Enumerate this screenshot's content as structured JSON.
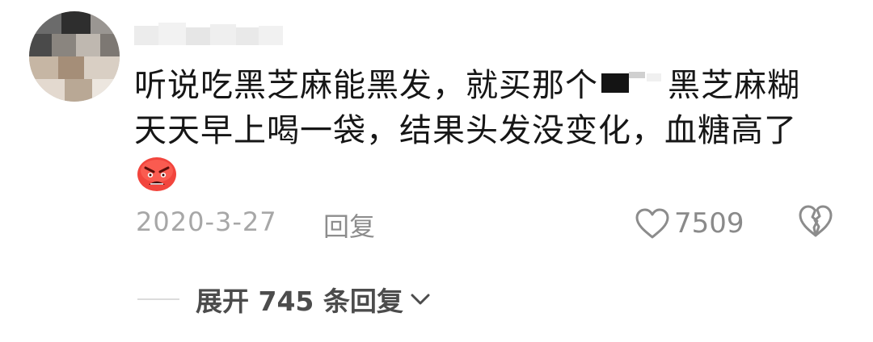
{
  "comment": {
    "line1_before": "听说吃黑芝麻能黑发，就买那个",
    "line1_after": "黑芝麻糊",
    "line2": "天天早上喝一袋，结果头发没变化，血糖高了",
    "emoji": "angry-face-icon"
  },
  "meta": {
    "date": "2020-3-27",
    "reply_label": "回复",
    "like_count": "7509"
  },
  "replies": {
    "expand_label": "展开 745 条回复"
  }
}
